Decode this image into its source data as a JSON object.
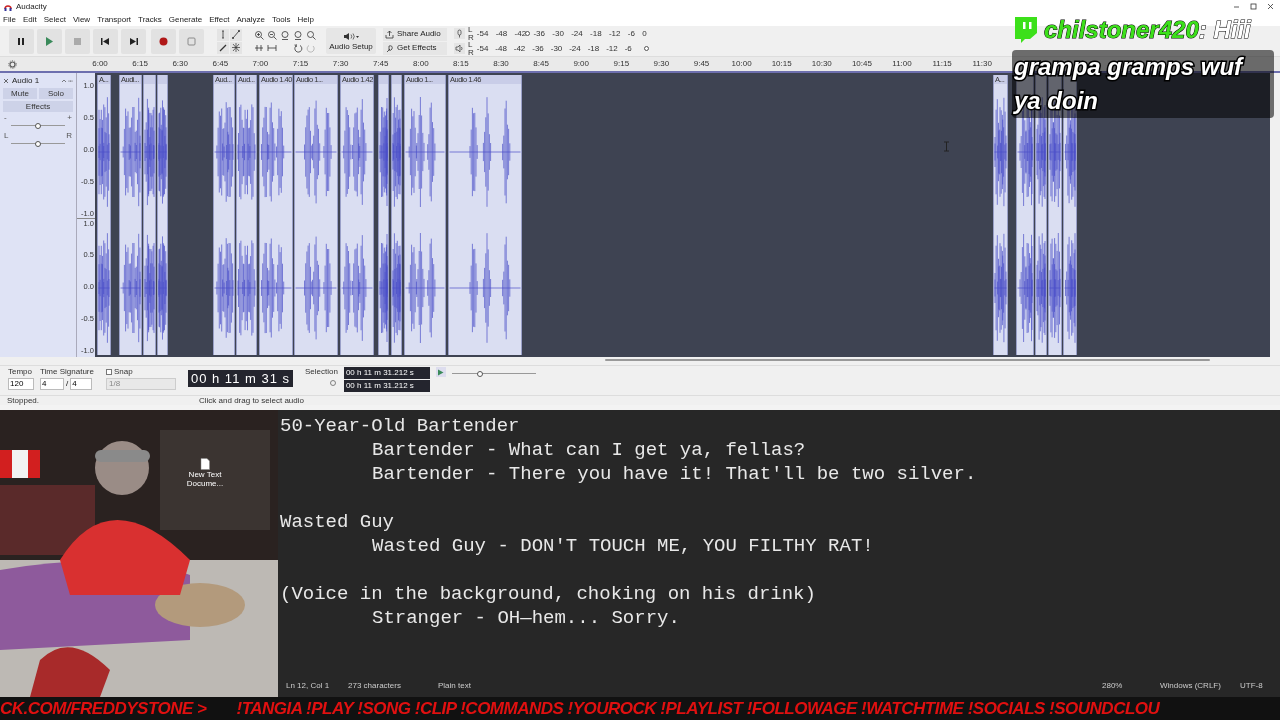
{
  "window": {
    "title": "Audacity"
  },
  "menu": [
    "File",
    "Edit",
    "Select",
    "View",
    "Transport",
    "Tracks",
    "Generate",
    "Effect",
    "Analyze",
    "Tools",
    "Help"
  ],
  "toolbar": {
    "audio_setup": "Audio Setup",
    "share_audio": "Share Audio",
    "get_effects": "Get Effects"
  },
  "meters": {
    "record_channels": [
      "L",
      "R"
    ],
    "record_scale": [
      "-54",
      "-48",
      "-42",
      "-36",
      "-30",
      "-24",
      "-18",
      "-12",
      "-6",
      "0"
    ],
    "record_volume": {
      "level": 0.3
    },
    "playback_channels": [
      "L",
      "R"
    ],
    "playback_scale": [
      "-54",
      "-48",
      "-42",
      "-36",
      "-30",
      "-24",
      "-18",
      "-12",
      "-6"
    ],
    "playback_volume": {
      "level": 1
    }
  },
  "ruler": [
    "6:00",
    "6:15",
    "6:30",
    "6:45",
    "7:00",
    "7:15",
    "7:30",
    "7:45",
    "8:00",
    "8:15",
    "8:30",
    "8:45",
    "9:00",
    "9:15",
    "9:30",
    "9:45",
    "10:00",
    "10:15",
    "10:30",
    "10:45",
    "11:00",
    "11:15",
    "11:30"
  ],
  "track": {
    "name": "Audio 1",
    "mute": "Mute",
    "solo": "Solo",
    "effects": "Effects",
    "gain_labels": [
      "-",
      "+"
    ],
    "gain": {
      "level": 0.5
    },
    "pan_labels": [
      "L",
      "R"
    ],
    "pan": {
      "level": 0.5
    },
    "channels": [
      {
        "scale": [
          "1.0",
          "0.5",
          "0.0",
          "-0.5",
          "-1.0"
        ]
      },
      {
        "scale": [
          "1.0",
          "0.5",
          "0.0",
          "-0.5",
          "-1.0"
        ]
      }
    ]
  },
  "clips": [
    {
      "kind": "titled",
      "label": "A..."
    },
    {
      "kind": "titled",
      "label": "Audi..."
    },
    {
      "kind": "untitled"
    },
    {
      "kind": "untitled"
    },
    {
      "kind": "titled",
      "label": "Aud..."
    },
    {
      "kind": "titled",
      "label": "Aud..."
    },
    {
      "kind": "titled",
      "label": "Audio 1.40"
    },
    {
      "kind": "titled",
      "label": "Audio 1..."
    },
    {
      "kind": "titled",
      "label": "Audio 1.42"
    },
    {
      "kind": "untitled"
    },
    {
      "kind": "untitled"
    },
    {
      "kind": "titled",
      "label": "Audio 1..."
    },
    {
      "kind": "titled",
      "label": "Audio 1.46"
    },
    {
      "kind": "titled",
      "label": "A..."
    },
    {
      "kind": "covered"
    },
    {
      "kind": "covered"
    },
    {
      "kind": "covered"
    },
    {
      "kind": "covered"
    }
  ],
  "bottom_toolbar": {
    "tempo_label": "Tempo",
    "tempo": "120",
    "time_signature_label": "Time Signature",
    "beats": "4",
    "separator": "/",
    "beat_unit": "4",
    "snap": {
      "label": "Snap",
      "checked": false
    },
    "snap_value": "1/8",
    "time": "00 h 11 m 31 s",
    "selection_label": "Selection",
    "selection_start": "00 h 11 m 31.212 s",
    "selection_end": "00 h 11 m 31.212 s",
    "play_speed": {
      "level": 0.33
    }
  },
  "status_bar": [
    "Stopped.",
    "Click and drag to select audio"
  ],
  "chat": {
    "user": "chilstoner420",
    "text": ": Hiii",
    "message": "grampa gramps wuf ya doin"
  },
  "desktop_icon": "New Text Docume...",
  "editor": {
    "blocks": [
      {
        "heading": "50-Year-Old Bartender",
        "lines": [
          "Bartender - What can I get ya, fellas?",
          "Bartender - There you have it! That'll be two silver."
        ]
      },
      {
        "heading": "Wasted Guy",
        "lines": [
          "Wasted Guy - DON'T TOUCH ME, YOU FILTHY RAT!"
        ]
      },
      {
        "heading": "(Voice in the background, choking on his drink)",
        "lines": [
          "Stranger - OH—hem... Sorry."
        ]
      }
    ],
    "status": [
      "Ln 12, Col 1",
      "273 characters",
      "Plain text",
      "280%",
      "Windows (CRLF)",
      "UTF-8"
    ]
  },
  "ticker": [
    "CK.COM/FREDDYSTONE >",
    "!TANGIA !PLAY !SONG !CLIP !COMMANDS !YOUROCK !PLAYLIST !FOLLOWAGE !WATCHTIME !SOCIALS !SOUNDCLOU"
  ]
}
